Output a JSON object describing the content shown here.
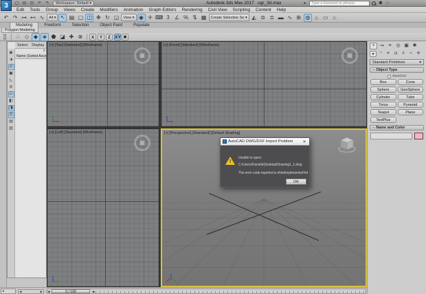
{
  "colors": {
    "active_viewport_border": "#d8c53a",
    "logo_blue": "#2e7cba",
    "toolbar_highlight_blue": "#aecbe2",
    "warning_yellow": "#f2c21b",
    "name_color_swatch": "#f0b6c8"
  },
  "titlebar": {
    "logo_text": "3",
    "quick_icons": [
      {
        "name": "new-scene-icon",
        "glyph": "▢"
      },
      {
        "name": "open-file-icon",
        "glyph": "⊟"
      },
      {
        "name": "save-file-icon",
        "glyph": "⊡"
      },
      {
        "name": "undo-quick-icon",
        "glyph": "↶"
      },
      {
        "name": "redo-quick-icon",
        "glyph": "↷"
      }
    ],
    "workspace_label": "Workspace: Default ▾",
    "app_title": "Autodesk 3ds Max 2017",
    "doc_name": "ugr_3d.max",
    "search_placeholder": "Type a keyword or phrase",
    "collapse_glyph": "▸"
  },
  "menubar": {
    "items": [
      {
        "label": "Edit"
      },
      {
        "label": "Tools"
      },
      {
        "label": "Group"
      },
      {
        "label": "Views"
      },
      {
        "label": "Create"
      },
      {
        "label": "Modifiers"
      },
      {
        "label": "Animation"
      },
      {
        "label": "Graph Editors"
      },
      {
        "label": "Rendering"
      },
      {
        "label": "Civil View"
      },
      {
        "label": "Scripting"
      },
      {
        "label": "Content"
      },
      {
        "label": "Help"
      }
    ]
  },
  "toolbar": {
    "items": [
      {
        "name": "undo-icon",
        "glyph": "↶"
      },
      {
        "name": "redo-icon",
        "glyph": "↷"
      },
      {
        "name": "select-and-link-icon",
        "glyph": "⊶"
      },
      {
        "name": "unlink-selection-icon",
        "glyph": "⊷"
      },
      {
        "name": "bind-to-space-warp-icon",
        "glyph": "∿"
      },
      {
        "name": "selection-filter-dropdown",
        "glyph": "All ▾",
        "wide": true
      },
      {
        "name": "select-object-icon",
        "glyph": "↖",
        "active": true
      },
      {
        "name": "select-by-name-icon",
        "glyph": "▤"
      },
      {
        "name": "rectangular-selection-region-icon",
        "glyph": "▢"
      },
      {
        "name": "window-crossing-icon",
        "glyph": "◫",
        "active": true
      },
      {
        "name": "select-and-move-icon",
        "glyph": "✥"
      },
      {
        "name": "select-and-rotate-icon",
        "glyph": "↻"
      },
      {
        "name": "select-and-scale-icon",
        "glyph": "◲"
      },
      {
        "name": "reference-coordinate-dropdown",
        "glyph": "View ▾",
        "wide": true
      },
      {
        "name": "use-pivot-point-center-icon",
        "glyph": "◉",
        "active": true
      },
      {
        "name": "select-and-manipulate-icon",
        "glyph": "✛"
      },
      {
        "name": "keyboard-shortcut-override-icon",
        "glyph": "⌨"
      },
      {
        "name": "snaps-toggle-3d-icon",
        "glyph": "3"
      },
      {
        "name": "angle-snap-icon",
        "glyph": "∠"
      },
      {
        "name": "percent-snap-icon",
        "glyph": "%"
      },
      {
        "name": "spinner-snap-icon",
        "glyph": "⇅"
      },
      {
        "name": "edit-named-selection-sets-icon",
        "glyph": "▦"
      },
      {
        "name": "named-selection-sets-dropdown",
        "glyph": "Create Selection Se ▾",
        "wide": true
      },
      {
        "name": "mirror-icon",
        "glyph": "◭"
      },
      {
        "name": "align-icon",
        "glyph": "⊜"
      },
      {
        "name": "layer-manager-icon",
        "glyph": "≣"
      },
      {
        "name": "ribbon-toggle-icon",
        "glyph": "▬"
      },
      {
        "name": "curve-editor-icon",
        "glyph": "∿"
      },
      {
        "name": "schematic-view-icon",
        "glyph": "⊞"
      },
      {
        "name": "material-editor-icon",
        "glyph": "◍",
        "active": true
      },
      {
        "name": "render-setup-icon",
        "glyph": "♨"
      },
      {
        "name": "rendered-frame-window-icon",
        "glyph": "▭"
      },
      {
        "name": "render-production-icon",
        "glyph": "♨"
      }
    ]
  },
  "ribbon": {
    "tabs": [
      {
        "label": "Modeling",
        "active": true
      },
      {
        "label": "Freeform"
      },
      {
        "label": "Selection"
      },
      {
        "label": "Object Paint"
      },
      {
        "label": "Populate"
      }
    ],
    "tab_overflow_glyph": "▭ ▾",
    "panel_tab": "Polygon Modeling",
    "grid_icon_glyph": "⣿",
    "tool_icons": [
      {
        "name": "subobject-vertex-icon",
        "glyph": "∴"
      },
      {
        "name": "subobject-edge-icon",
        "glyph": "◇"
      },
      {
        "name": "subobject-border-icon",
        "glyph": "◆",
        "active": true
      },
      {
        "name": "subobject-polygon-icon",
        "glyph": "◈",
        "active": true
      },
      {
        "name": "subobject-element-icon",
        "glyph": "⬟"
      },
      {
        "name": "pivot-mode-icon",
        "glyph": "◪"
      },
      {
        "name": "preview-selection-icon",
        "glyph": "✚"
      },
      {
        "name": "ignore-backfacing-icon",
        "glyph": "⊗"
      }
    ],
    "constraints": [
      {
        "label": "X",
        "name": "restrict-x-button"
      },
      {
        "label": "Y",
        "name": "restrict-y-button"
      },
      {
        "label": "Z",
        "name": "restrict-z-button"
      },
      {
        "label": "XY",
        "name": "restrict-plane-button",
        "active": true
      }
    ],
    "constraint_extra_glyph": "✖"
  },
  "explorer": {
    "menus": [
      {
        "label": "Select"
      },
      {
        "label": "Display"
      }
    ],
    "overflow_glyph": "»",
    "column_header": "Name (Sorted Ascendi",
    "side_icons": [
      {
        "name": "display-influences-icon",
        "glyph": "◉"
      },
      {
        "name": "display-objects-icon",
        "glyph": "⬗"
      },
      {
        "name": "display-shapes-icon",
        "glyph": "◎",
        "active": true
      },
      {
        "name": "display-lights-icon",
        "glyph": "▣"
      },
      {
        "name": "display-cameras-icon",
        "glyph": "◺"
      },
      {
        "name": "display-helpers-icon",
        "glyph": "⊘"
      },
      {
        "name": "display-materials-icon",
        "glyph": "☑",
        "active": true
      },
      {
        "name": "display-bones-icon",
        "glyph": "◧"
      },
      {
        "name": "display-containers-icon",
        "glyph": "◨",
        "active": true
      },
      {
        "name": "display-frozen-icon",
        "glyph": "⊡",
        "active": true
      },
      {
        "name": "display-hidden-icon",
        "glyph": "▤"
      },
      {
        "name": "display-layers-icon",
        "glyph": "▥"
      }
    ]
  },
  "viewports": {
    "top": {
      "label": "[+] [Top] [Standard] [Wireframe]"
    },
    "front": {
      "label": "[+] [Front] [Standard] [Wireframe]"
    },
    "left": {
      "label": "[+] [Left] [Standard] [Wireframe]"
    },
    "perspective": {
      "label": "[+] [Perspective] [Standard] [Default Shading]"
    }
  },
  "dialog": {
    "title": "AutoCAD DWG/DXF Import Problem",
    "close_glyph": "✕",
    "line1": "Unable to open:",
    "line2": "C:\\Users\\Daniela\\Desktop\\Drawing1_1.dwg",
    "line3": "The error code reported is eNotImplementedYet",
    "ok_label": "OK"
  },
  "command_panel": {
    "tabs": [
      {
        "name": "create-tab-icon",
        "glyph": "+",
        "active": true
      },
      {
        "name": "modify-tab-icon",
        "glyph": "↝"
      },
      {
        "name": "hierarchy-tab-icon",
        "glyph": "≡"
      },
      {
        "name": "motion-tab-icon",
        "glyph": "◎"
      },
      {
        "name": "display-tab-icon",
        "glyph": "▣"
      },
      {
        "name": "utilities-tab-icon",
        "glyph": "✱"
      }
    ],
    "sub_tabs": [
      {
        "name": "geometry-category-icon",
        "glyph": "●",
        "active": true
      },
      {
        "name": "shapes-category-icon",
        "glyph": "◠"
      },
      {
        "name": "lights-category-icon",
        "glyph": "☀"
      },
      {
        "name": "cameras-category-icon",
        "glyph": "◘"
      },
      {
        "name": "helpers-category-icon",
        "glyph": "#"
      },
      {
        "name": "space-warps-category-icon",
        "glyph": "≈"
      },
      {
        "name": "systems-category-icon",
        "glyph": "✣"
      }
    ],
    "dropdown_value": "Standard Primitives",
    "dropdown_arrow": "▾",
    "object_type_rollout": "Object Type",
    "rollout_toggle": "−",
    "autogrid_label": "AutoGrid",
    "object_buttons": [
      {
        "label": "Box"
      },
      {
        "label": "Cone"
      },
      {
        "label": "Sphere"
      },
      {
        "label": "GeoSphere"
      },
      {
        "label": "Cylinder"
      },
      {
        "label": "Tube"
      },
      {
        "label": "Torus"
      },
      {
        "label": "Pyramid"
      },
      {
        "label": "Teapot"
      },
      {
        "label": "Plane"
      },
      {
        "label": "TextPlus"
      }
    ],
    "name_color_rollout": "Name and Color"
  },
  "timeline": {
    "frame_label": "0 / 100",
    "left_arrow": "◀",
    "right_arrow": "▶",
    "mini_listener_glyph": "▸",
    "scroll_left": "◀",
    "scroll_right": "▶"
  }
}
